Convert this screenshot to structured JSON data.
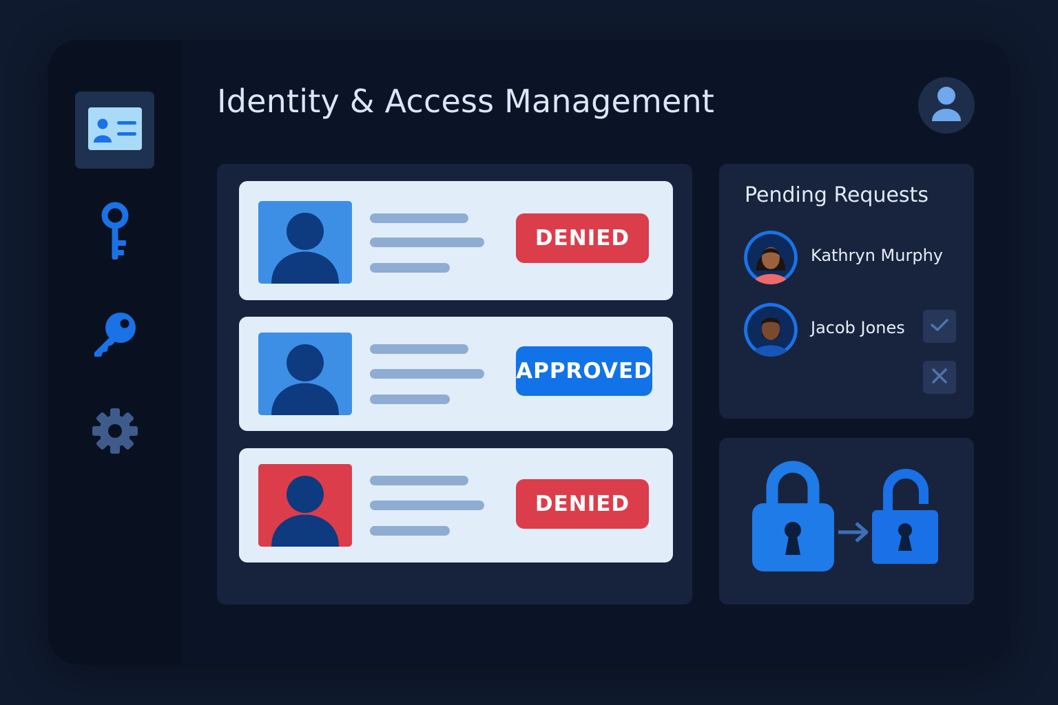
{
  "app": {
    "title": "Identity & Access Management"
  },
  "sidebar": {
    "items": [
      {
        "icon": "id-card-icon",
        "active": true
      },
      {
        "icon": "key-icon",
        "active": false
      },
      {
        "icon": "key-icon",
        "active": false
      },
      {
        "icon": "gear-icon",
        "active": false
      }
    ]
  },
  "header": {
    "user_icon": "user-avatar-icon"
  },
  "records": [
    {
      "status": "DENIED",
      "photo_color": "#3d8fe6",
      "badge_color": "#dc3d4b"
    },
    {
      "status": "APPROVED",
      "photo_color": "#3d8fe6",
      "badge_color": "#1273e8"
    },
    {
      "status": "DENIED",
      "photo_color": "#dc3d4b",
      "badge_color": "#dc3d4b"
    }
  ],
  "pending": {
    "title": "Pending Requests",
    "requests": [
      {
        "name": "Kathryn Murphy"
      },
      {
        "name": "Jacob Jones"
      }
    ],
    "approve_icon": "check-icon",
    "reject_icon": "close-icon"
  },
  "lock_illustration": {
    "from": "lock-closed-icon",
    "to": "lock-open-icon",
    "arrow": "arrow-right-icon"
  },
  "colors": {
    "background": "#0f1a2e",
    "accent": "#1e7be8",
    "denied": "#dc3d4b",
    "approved": "#1273e8",
    "card": "#e1eef9",
    "panel": "#17233d"
  }
}
